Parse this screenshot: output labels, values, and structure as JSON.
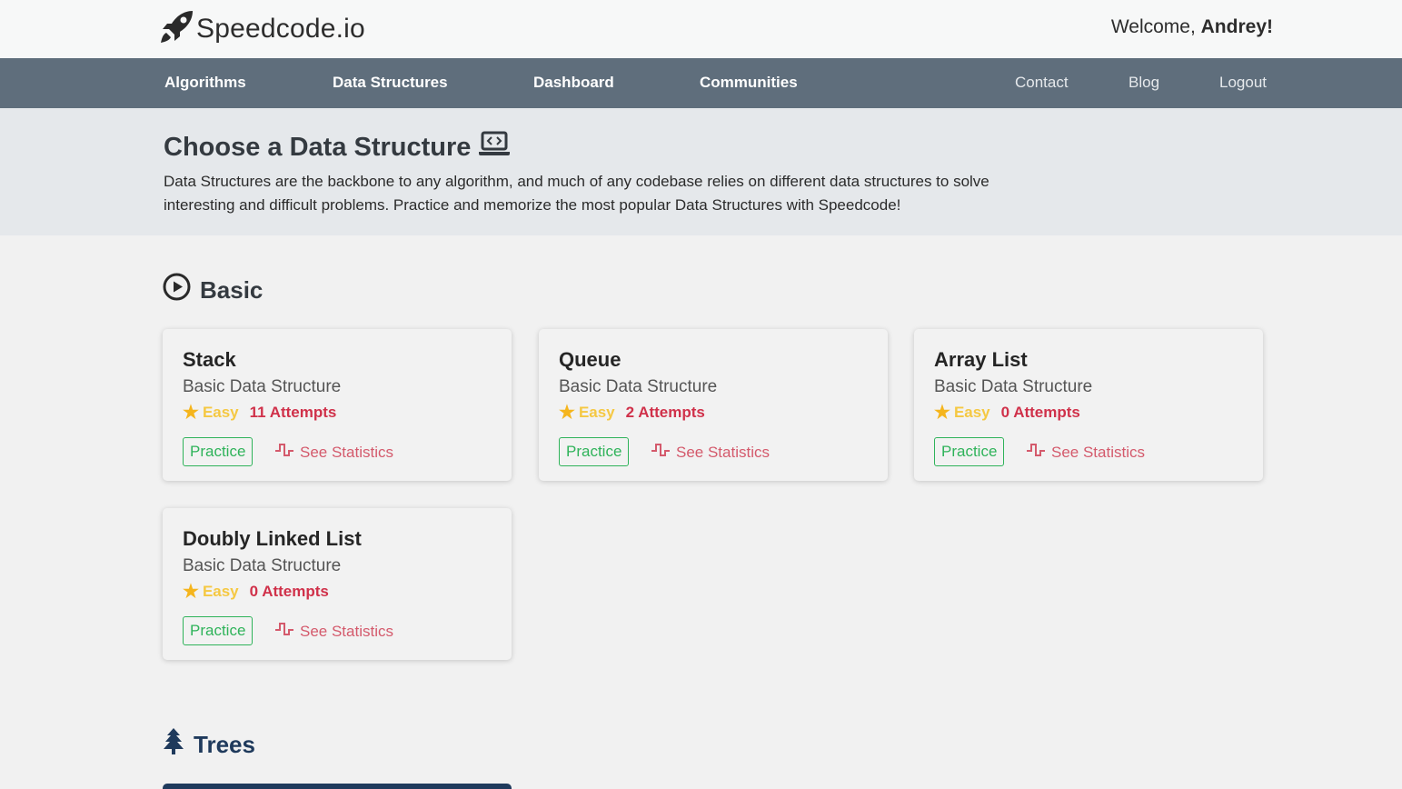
{
  "brand": {
    "name": "Speedcode.io"
  },
  "header": {
    "welcome_prefix": "Welcome, ",
    "user_name": "Andrey!"
  },
  "nav": {
    "algorithms": "Algorithms",
    "data_structures": "Data Structures",
    "dashboard": "Dashboard",
    "communities": "Communities",
    "contact": "Contact",
    "blog": "Blog",
    "logout": "Logout"
  },
  "hero": {
    "title": "Choose a Data Structure",
    "description": "Data Structures are the backbone to any algorithm, and much of any codebase relies on different data structures to solve interesting and difficult problems. Practice and memorize the most popular Data Structures with Speedcode!"
  },
  "sections": {
    "basic": {
      "title": "Basic",
      "icon": "play-circle-icon"
    },
    "trees": {
      "title": "Trees",
      "icon": "tree-icon"
    }
  },
  "cards": [
    {
      "title": "Stack",
      "subtitle": "Basic Data Structure",
      "difficulty": "Easy",
      "attempts": "11 Attempts",
      "practice": "Practice",
      "stats": "See Statistics"
    },
    {
      "title": "Queue",
      "subtitle": "Basic Data Structure",
      "difficulty": "Easy",
      "attempts": "2 Attempts",
      "practice": "Practice",
      "stats": "See Statistics"
    },
    {
      "title": "Array List",
      "subtitle": "Basic Data Structure",
      "difficulty": "Easy",
      "attempts": "0 Attempts",
      "practice": "Practice",
      "stats": "See Statistics"
    },
    {
      "title": "Doubly Linked List",
      "subtitle": "Basic Data Structure",
      "difficulty": "Easy",
      "attempts": "0 Attempts",
      "practice": "Practice",
      "stats": "See Statistics"
    }
  ],
  "colors": {
    "navbar": "#5f6e7c",
    "practice": "#2fb35a",
    "difficulty": "#f5c842",
    "attempts": "#d0314a",
    "stats": "#d45a6c",
    "trees_heading": "#1f3a5c"
  }
}
